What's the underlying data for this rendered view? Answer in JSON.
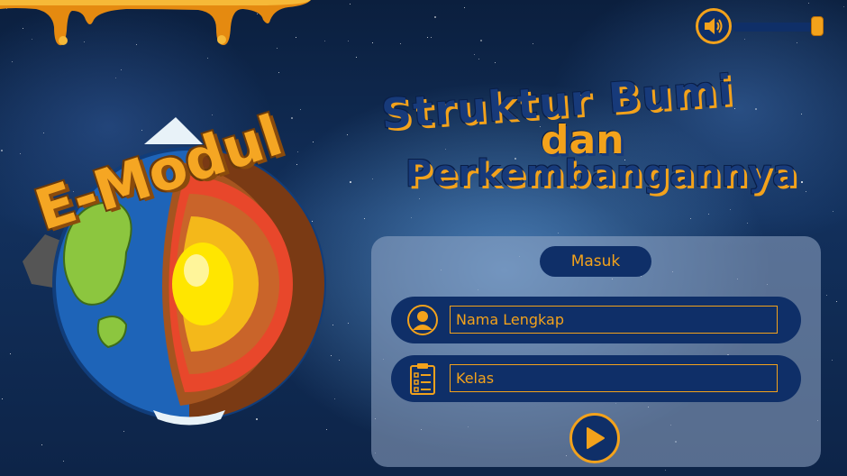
{
  "title": {
    "line1": "Struktur Bumi",
    "line2": "dan",
    "line3": "Perkembangannya"
  },
  "emblem": {
    "label": "E-Modul",
    "image": "earth-layers-cutaway-icon"
  },
  "volume": {
    "icon": "speaker-icon",
    "level": 1.0
  },
  "login": {
    "heading": "Masuk",
    "name_placeholder": "Nama Lengkap",
    "name_value": "",
    "class_placeholder": "Kelas",
    "class_value": "",
    "name_icon": "user-icon",
    "class_icon": "clipboard-checklist-icon",
    "submit_icon": "play-icon"
  },
  "colors": {
    "accent": "#f3a21b",
    "panel_dark": "#0f2f68",
    "title_blue": "#173a7a"
  }
}
